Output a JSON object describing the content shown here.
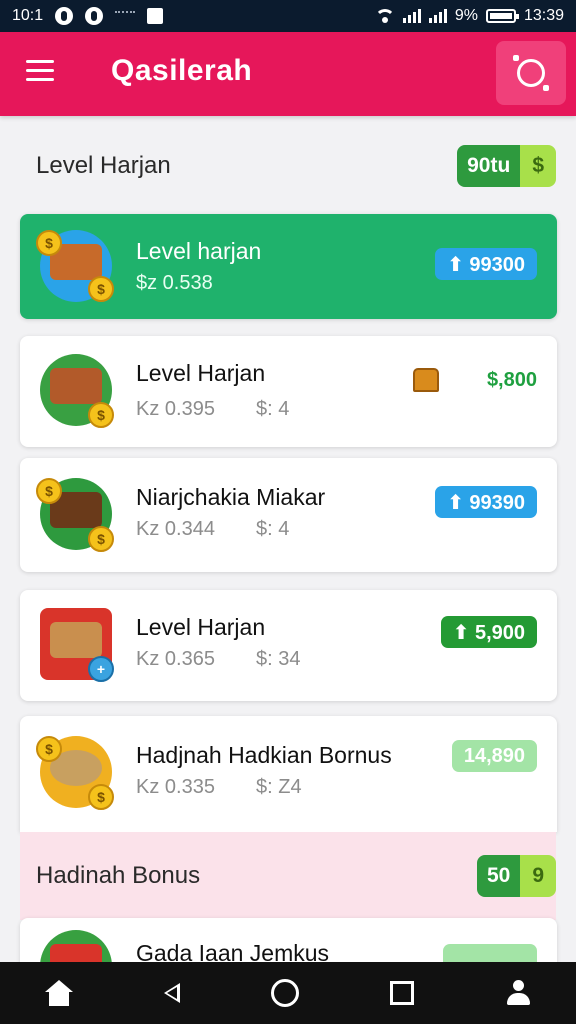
{
  "status_bar": {
    "time_left": "10:1",
    "battery_percent": "9%",
    "time_right": "13:39"
  },
  "app_bar": {
    "title": "Qasilerah",
    "menu_icon": "hamburger-icon",
    "action_icon": "support-icon"
  },
  "sections": [
    {
      "title": "Level Harjan",
      "pill_left": "90tu",
      "pill_right": "$"
    },
    {
      "title": "Hadinah Bonus",
      "pill_left": "50",
      "pill_right": "9"
    }
  ],
  "cards": [
    {
      "title": "Level harjan",
      "sub1": "$z 0.538",
      "sub2": "",
      "badge": "⬆ 99300",
      "badge_style": "blue",
      "featured": true,
      "colors": [
        "#2aa3e8",
        "#c76a2a"
      ]
    },
    {
      "title": "Level Harjan",
      "sub1": "Kz 0.395",
      "sub2": "$: 4",
      "badge": "$,800",
      "badge_style": "plain",
      "featured": false,
      "colors": [
        "#39a042",
        "#b25a2a"
      ]
    },
    {
      "title": "Niarjchakia Miakar",
      "sub1": "Kz 0.344",
      "sub2": "$: 4",
      "badge": "⬆ 99390",
      "badge_style": "blue",
      "featured": false,
      "colors": [
        "#2e9a3e",
        "#6a3a1a"
      ]
    },
    {
      "title": "Level Harjan",
      "sub1": "Kz 0.365",
      "sub2": "$: 34",
      "badge": "⬆ 5,900",
      "badge_style": "green",
      "featured": false,
      "colors": [
        "#d9342a",
        "#c98f4e"
      ]
    },
    {
      "title": "Hadjnah Hadkian Bornus",
      "sub1": "Kz 0.335",
      "sub2": "$: Z4",
      "badge": "14,890",
      "badge_style": "lightgreen",
      "featured": false,
      "colors": [
        "#f0b020",
        "#c8a060"
      ]
    },
    {
      "title": "Gada Iaan Jemkus",
      "sub1": "",
      "sub2": "",
      "badge": "",
      "badge_style": "lightgreen",
      "featured": false,
      "colors": [
        "#d9342a",
        "#38a040"
      ]
    }
  ],
  "nav": {
    "home": "home-icon",
    "back": "back-icon",
    "overview": "circle-icon",
    "recents": "square-icon",
    "profile": "user-icon"
  }
}
